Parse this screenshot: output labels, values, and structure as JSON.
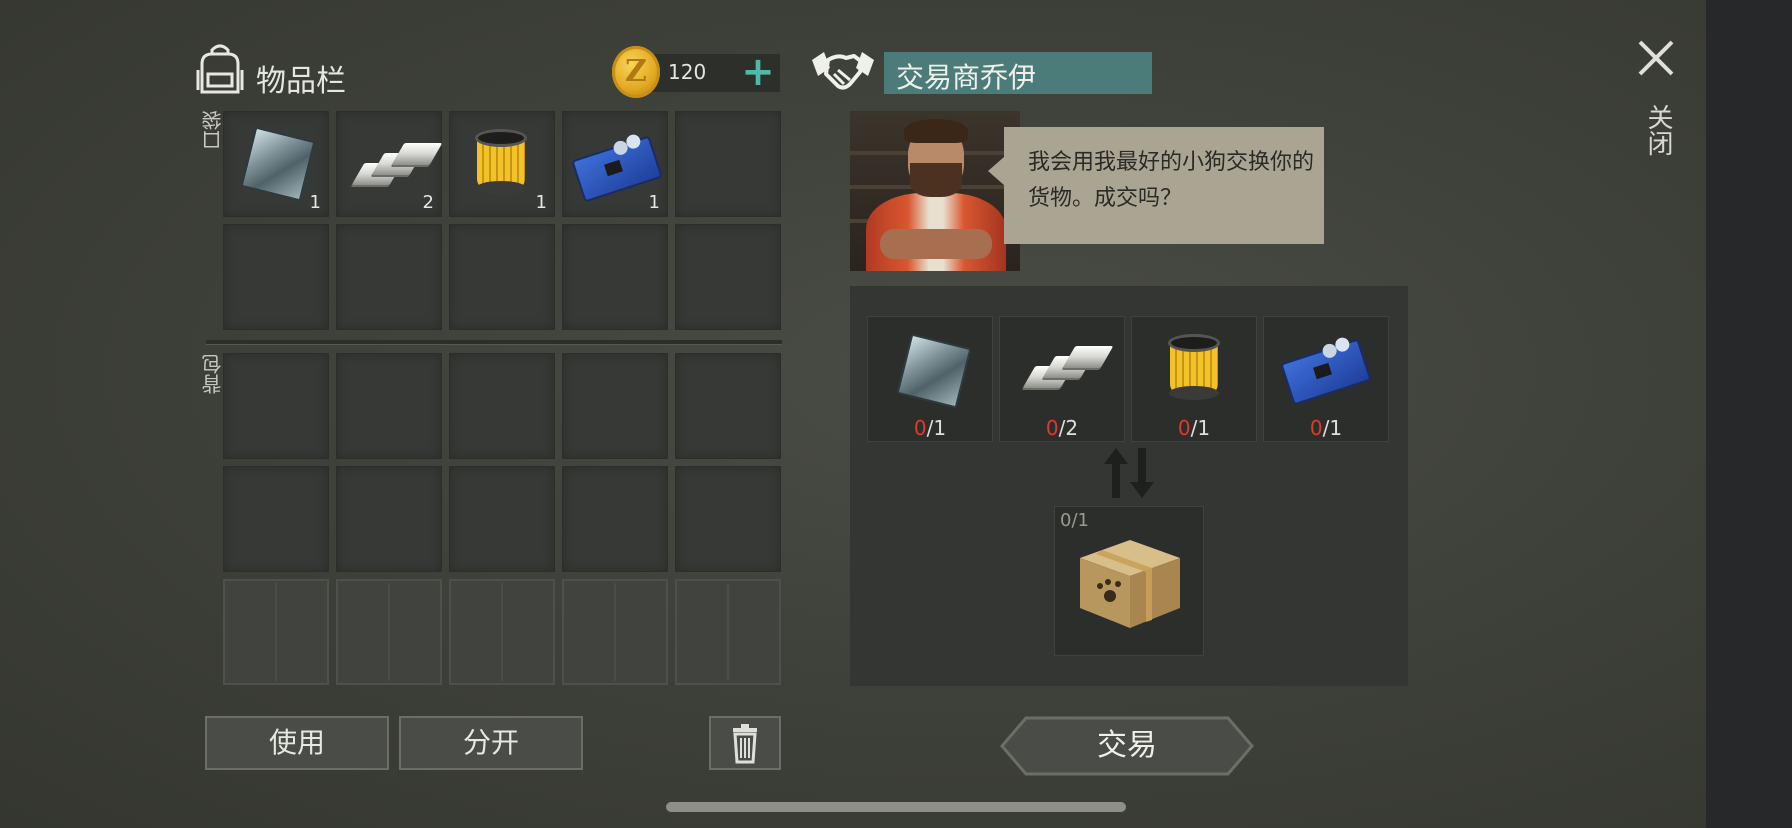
{
  "inventory": {
    "title": "物品栏",
    "coins": "120",
    "add_symbol": "+",
    "coin_letter": "Z",
    "pocket_label": "口袋",
    "backpack_label": "背包",
    "pocket_slots": [
      {
        "item": "metal-plate-icon",
        "qty": "1"
      },
      {
        "item": "silver-bars-icon",
        "qty": "2"
      },
      {
        "item": "oil-filter-icon",
        "qty": "1"
      },
      {
        "item": "circuit-board-icon",
        "qty": "1"
      },
      {
        "item": "",
        "qty": ""
      }
    ]
  },
  "trader": {
    "name": "交易商乔伊",
    "dialogue": "我会用我最好的小狗交换你的货物。成交吗？",
    "requirements": [
      {
        "item": "metal-plate-icon",
        "have": "0",
        "need": "/1"
      },
      {
        "item": "silver-bars-icon",
        "have": "0",
        "need": "/2"
      },
      {
        "item": "oil-filter-icon",
        "have": "0",
        "need": "/1"
      },
      {
        "item": "circuit-board-icon",
        "have": "0",
        "need": "/1"
      }
    ],
    "reward": {
      "item": "dog-crate-icon",
      "count": "0/1"
    }
  },
  "buttons": {
    "use": "使用",
    "split": "分开",
    "trade": "交易",
    "close": "关闭"
  },
  "colors": {
    "accent_teal": "#4b7c7a",
    "plus_teal": "#4fb8a8",
    "missing_red": "#e0392e",
    "coin_gold": "#e3aa21"
  }
}
